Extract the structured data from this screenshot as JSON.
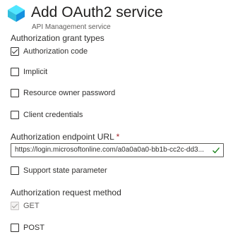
{
  "header": {
    "title": "Add OAuth2 service",
    "subtitle": "API Management service",
    "logo_icon": "api-management-cloud-icon"
  },
  "form": {
    "grant_types": {
      "label": "Authorization grant types",
      "options": [
        {
          "label": "Authorization code",
          "checked": true
        },
        {
          "label": "Implicit",
          "checked": false
        },
        {
          "label": "Resource owner password",
          "checked": false
        },
        {
          "label": "Client credentials",
          "checked": false
        }
      ]
    },
    "endpoint": {
      "label": "Authorization endpoint URL",
      "required_mark": "*",
      "value": "https://login.microsoftonline.com/a0a0a0a0-bb1b-cc2c-dd3...",
      "valid_icon": "checkmark-icon"
    },
    "support_state": {
      "label": "Support state parameter",
      "checked": false
    },
    "request_method": {
      "label": "Authorization request method",
      "options": [
        {
          "label": "GET",
          "checked": true,
          "disabled": true
        },
        {
          "label": "POST",
          "checked": false,
          "disabled": false
        }
      ]
    }
  },
  "colors": {
    "accent": "#0078d4",
    "logo_light": "#50e6ff",
    "valid": "#107c10",
    "required": "#a4262c"
  }
}
